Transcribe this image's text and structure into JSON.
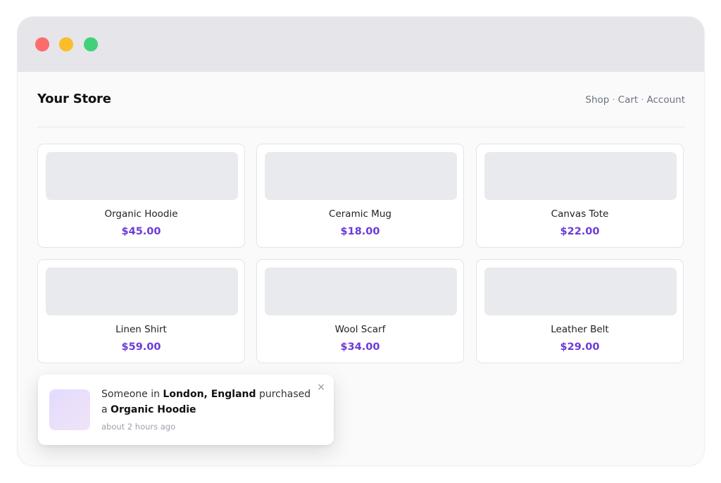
{
  "window": {
    "controls": {
      "close_color": "#fb6c6c",
      "minimize_color": "#fbbd2a",
      "maximize_color": "#42d17a"
    }
  },
  "header": {
    "store_title": "Your Store",
    "nav": [
      "Shop",
      "Cart",
      "Account"
    ],
    "nav_separator": "·"
  },
  "products": [
    {
      "name": "Organic Hoodie",
      "price": "$45.00"
    },
    {
      "name": "Ceramic Mug",
      "price": "$18.00"
    },
    {
      "name": "Canvas Tote",
      "price": "$22.00"
    },
    {
      "name": "Linen Shirt",
      "price": "$59.00"
    },
    {
      "name": "Wool Scarf",
      "price": "$34.00"
    },
    {
      "name": "Leather Belt",
      "price": "$29.00"
    }
  ],
  "notification": {
    "prefix": "Someone in",
    "location": "London, England",
    "verb": "purchased",
    "article": "a",
    "product": "Organic Hoodie",
    "time": "about 2 hours ago",
    "close_icon": "×"
  },
  "colors": {
    "accent": "#6c3bd8",
    "titlebar": "#e5e5ea"
  }
}
